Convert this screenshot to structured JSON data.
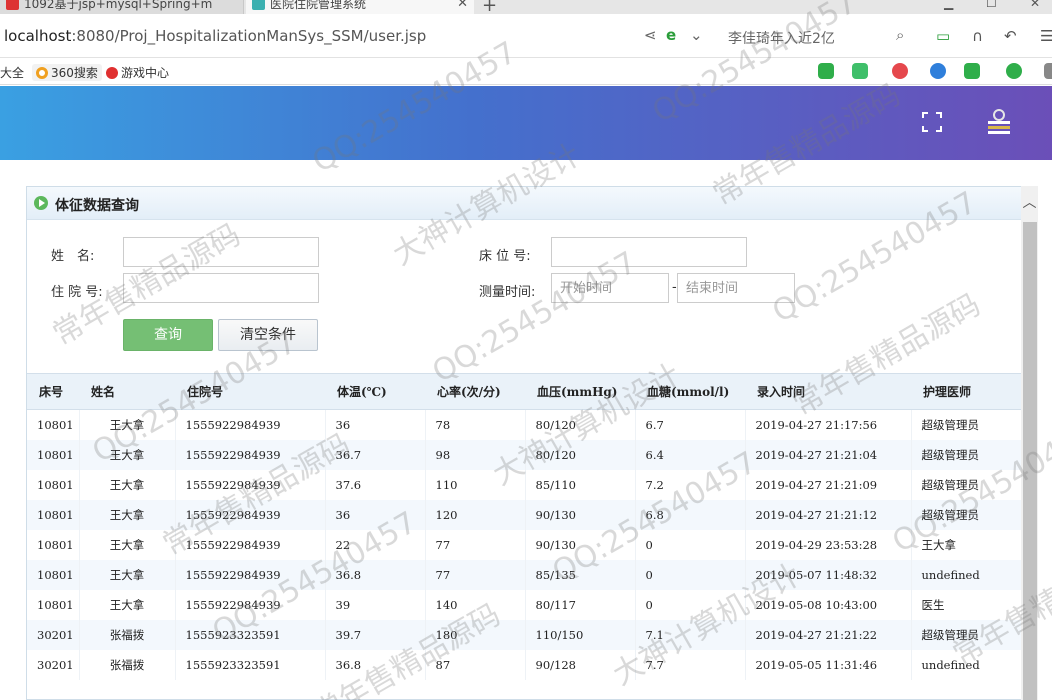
{
  "browser": {
    "tab1_title": "1092基于jsp+mysql+Spring+m",
    "tab2_title": "医院住院管理系统",
    "url_host": "localhost",
    "url_rest": ":8080/Proj_HospitalizationManSys_SSM/user.jsp",
    "news": "李佳琦年入近2亿",
    "bookmarks": [
      "大全",
      "360搜索",
      "游戏中心"
    ]
  },
  "panel": {
    "title": "体征数据查询"
  },
  "form": {
    "name_label": "姓　名:",
    "bed_label": "床 位 号:",
    "hosp_label": "住 院 号:",
    "time_label": "测量时间:",
    "start_placeholder": "开始时间",
    "end_placeholder": "结束时间",
    "dash": "-",
    "query_button": "查询",
    "clear_button": "清空条件"
  },
  "table": {
    "columns": [
      "床号",
      "姓名",
      "住院号",
      "体温(℃)",
      "心率(次/分)",
      "血压(mmHg)",
      "血糖(mmol/l)",
      "录入时间",
      "护理医师"
    ],
    "rows": [
      [
        "10801",
        "王大拿",
        "1555922984939",
        "36",
        "78",
        "80/120",
        "6.7",
        "2019-04-27 21:17:56",
        "超级管理员"
      ],
      [
        "10801",
        "王大拿",
        "1555922984939",
        "36.7",
        "98",
        "80/120",
        "6.4",
        "2019-04-27 21:21:04",
        "超级管理员"
      ],
      [
        "10801",
        "王大拿",
        "1555922984939",
        "37.6",
        "110",
        "85/110",
        "7.2",
        "2019-04-27 21:21:09",
        "超级管理员"
      ],
      [
        "10801",
        "王大拿",
        "1555922984939",
        "36",
        "120",
        "90/130",
        "6.8",
        "2019-04-27 21:21:12",
        "超级管理员"
      ],
      [
        "10801",
        "王大拿",
        "1555922984939",
        "22",
        "77",
        "90/130",
        "0",
        "2019-04-29 23:53:28",
        "王大拿"
      ],
      [
        "10801",
        "王大拿",
        "1555922984939",
        "36.8",
        "77",
        "85/135",
        "0",
        "2019-05-07 11:48:32",
        "undefined"
      ],
      [
        "10801",
        "王大拿",
        "1555922984939",
        "39",
        "140",
        "80/117",
        "0",
        "2019-05-08 10:43:00",
        "医生"
      ],
      [
        "30201",
        "张福拨",
        "1555923323591",
        "39.7",
        "180",
        "110/150",
        "7.1",
        "2019-04-27 21:21:22",
        "超级管理员"
      ],
      [
        "30201",
        "张福拨",
        "1555923323591",
        "36.8",
        "87",
        "90/128",
        "7.7",
        "2019-05-05 11:31:46",
        "undefined"
      ]
    ]
  },
  "watermarks": [
    "QQ:254540457",
    "常年售精品源码",
    "大神计算机设计"
  ]
}
